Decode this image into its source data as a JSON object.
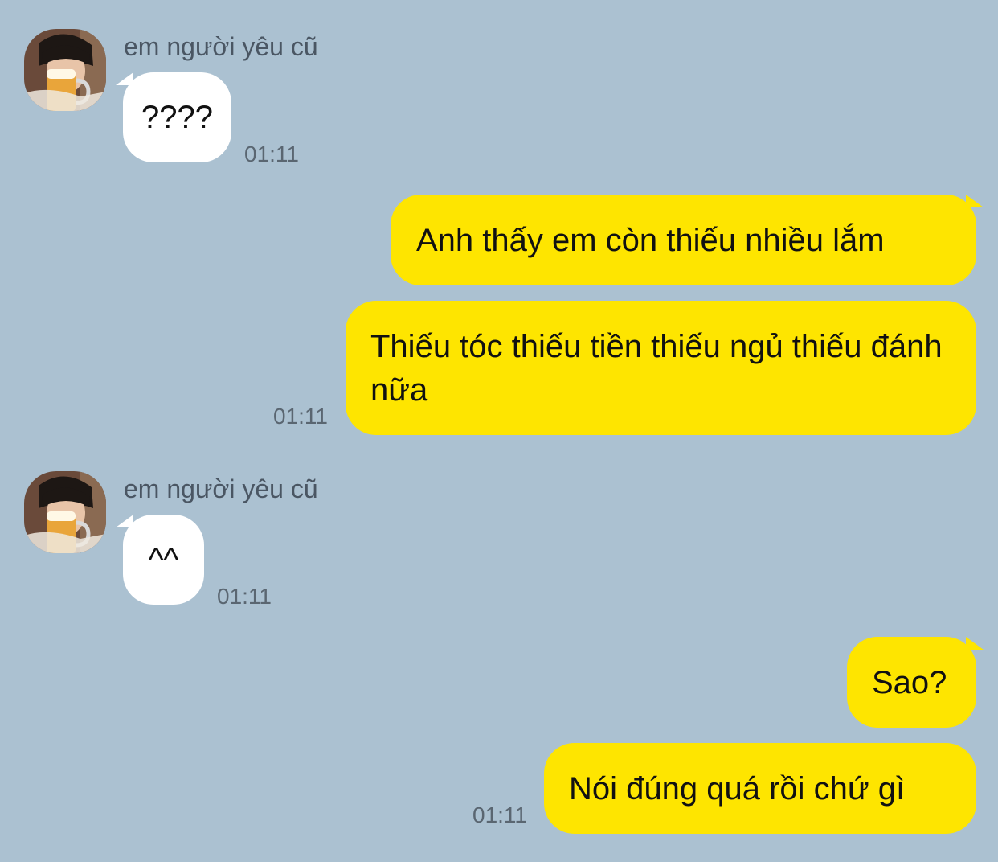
{
  "chat": {
    "messages": [
      {
        "sender_name": "em người yêu cũ",
        "text": "????",
        "time": "01:11"
      },
      {
        "text": "Anh thấy em còn thiếu nhiều lắm"
      },
      {
        "text": "Thiếu tóc thiếu tiền thiếu ngủ thiếu đánh nữa",
        "time": "01:11"
      },
      {
        "sender_name": "em người yêu cũ",
        "text": "^^",
        "time": "01:11"
      },
      {
        "text": "Sao?"
      },
      {
        "text": "Nói đúng quá rồi chứ gì",
        "time": "01:11"
      }
    ]
  },
  "colors": {
    "background": "#abc1d1",
    "incoming_bubble": "#ffffff",
    "outgoing_bubble": "#fee500"
  },
  "icons": {
    "avatar": "profile-photo-icon"
  }
}
